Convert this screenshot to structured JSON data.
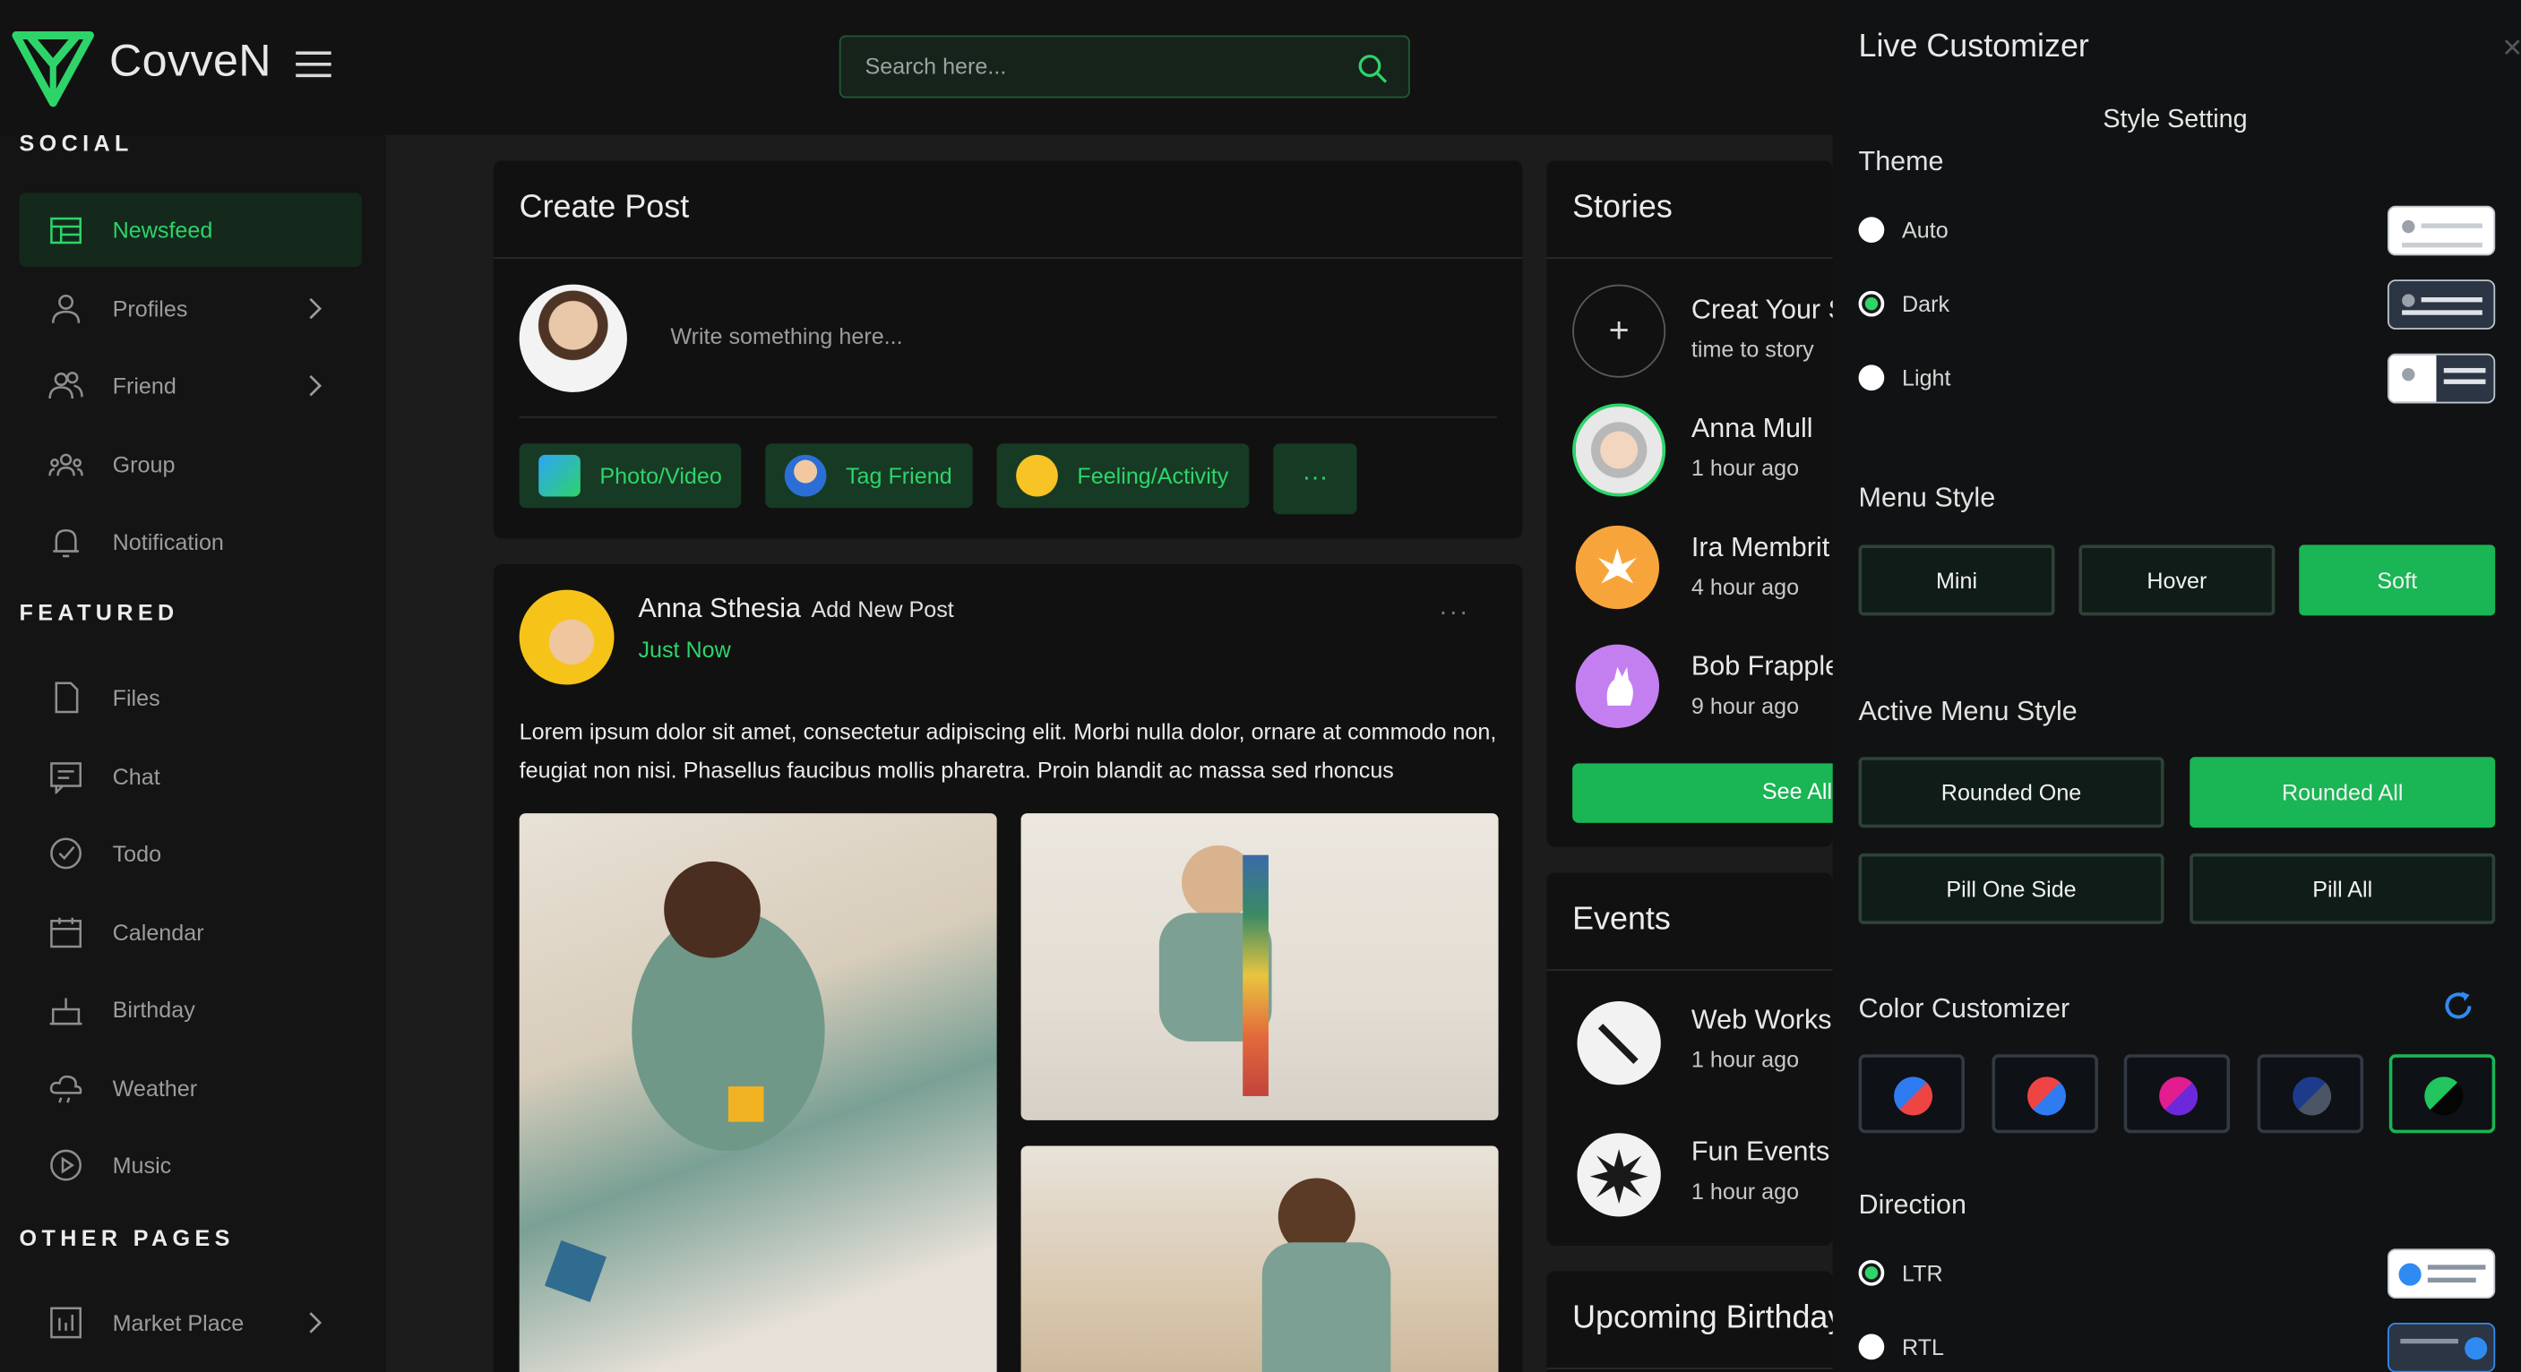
{
  "header": {
    "brand": "CovveN",
    "search_placeholder": "Search here..."
  },
  "sidebar": {
    "sections": [
      "SOCIAL",
      "FEATURED",
      "OTHER PAGES"
    ],
    "social": [
      {
        "label": "Newsfeed",
        "icon": "newsfeed-icon",
        "active": true
      },
      {
        "label": "Profiles",
        "icon": "user-icon",
        "chevron": true
      },
      {
        "label": "Friend",
        "icon": "friends-icon",
        "chevron": true
      },
      {
        "label": "Group",
        "icon": "group-icon"
      },
      {
        "label": "Notification",
        "icon": "bell-icon"
      }
    ],
    "featured": [
      {
        "label": "Files",
        "icon": "file-icon"
      },
      {
        "label": "Chat",
        "icon": "chat-icon"
      },
      {
        "label": "Todo",
        "icon": "todo-icon"
      },
      {
        "label": "Calendar",
        "icon": "calendar-icon"
      },
      {
        "label": "Birthday",
        "icon": "cake-icon"
      },
      {
        "label": "Weather",
        "icon": "weather-icon"
      },
      {
        "label": "Music",
        "icon": "music-icon"
      }
    ],
    "other": [
      {
        "label": "Market Place",
        "icon": "market-icon",
        "chevron": true
      }
    ]
  },
  "create_post": {
    "title": "Create Post",
    "input_placeholder": "Write something here...",
    "buttons": [
      "Photo/Video",
      "Tag Friend",
      "Feeling/Activity"
    ],
    "more": "···"
  },
  "post": {
    "author": "Anna Sthesia",
    "action": "Add New Post",
    "time": "Just Now",
    "body_line1": "Lorem ipsum dolor sit amet, consectetur adipiscing elit. Morbi nulla dolor, ornare at commodo non,",
    "body_line2": "feugiat non nisi. Phasellus faucibus mollis pharetra. Proin blandit ac massa sed rhoncus",
    "menu": "···"
  },
  "stories": {
    "title": "Stories",
    "items": [
      {
        "name": "Creat Your Story",
        "time": "time to story"
      },
      {
        "name": "Anna Mull",
        "time": "1 hour ago"
      },
      {
        "name": "Ira Membrit",
        "time": "4 hour ago"
      },
      {
        "name": "Bob Frapples",
        "time": "9 hour ago"
      }
    ],
    "see_all": "See All"
  },
  "events": {
    "title": "Events",
    "items": [
      {
        "name": "Web Workshop",
        "time": "1 hour ago"
      },
      {
        "name": "Fun Events",
        "time": "1 hour ago"
      }
    ]
  },
  "upcoming": {
    "title": "Upcoming Birthday"
  },
  "customizer": {
    "title": "Live Customizer",
    "subtitle": "Style Setting",
    "theme": {
      "label": "Theme",
      "options": [
        "Auto",
        "Dark",
        "Light"
      ],
      "selected": "Dark"
    },
    "menu_style": {
      "label": "Menu Style",
      "options": [
        "Mini",
        "Hover",
        "Soft"
      ],
      "selected": "Soft"
    },
    "active_menu_style": {
      "label": "Active Menu Style",
      "options": [
        "Rounded One",
        "Rounded All",
        "Pill One Side",
        "Pill All"
      ],
      "selected": "Rounded All"
    },
    "color_customizer": {
      "label": "Color Customizer",
      "swatches": [
        {
          "a": "#2f7bf2",
          "b": "#ef4444"
        },
        {
          "a": "#ef4444",
          "b": "#2f7bf2"
        },
        {
          "a": "#e11d8f",
          "b": "#6d28d9"
        },
        {
          "a": "#1e3a8a",
          "b": "#4b5563"
        },
        {
          "a": "#22c55e",
          "b": "#050505"
        }
      ],
      "selected_index": 4
    },
    "direction": {
      "label": "Direction",
      "options": [
        "LTR",
        "RTL"
      ],
      "selected": "LTR"
    }
  },
  "colors": {
    "accent": "#2ed46a",
    "bg": "#131313",
    "card": "#111111"
  }
}
